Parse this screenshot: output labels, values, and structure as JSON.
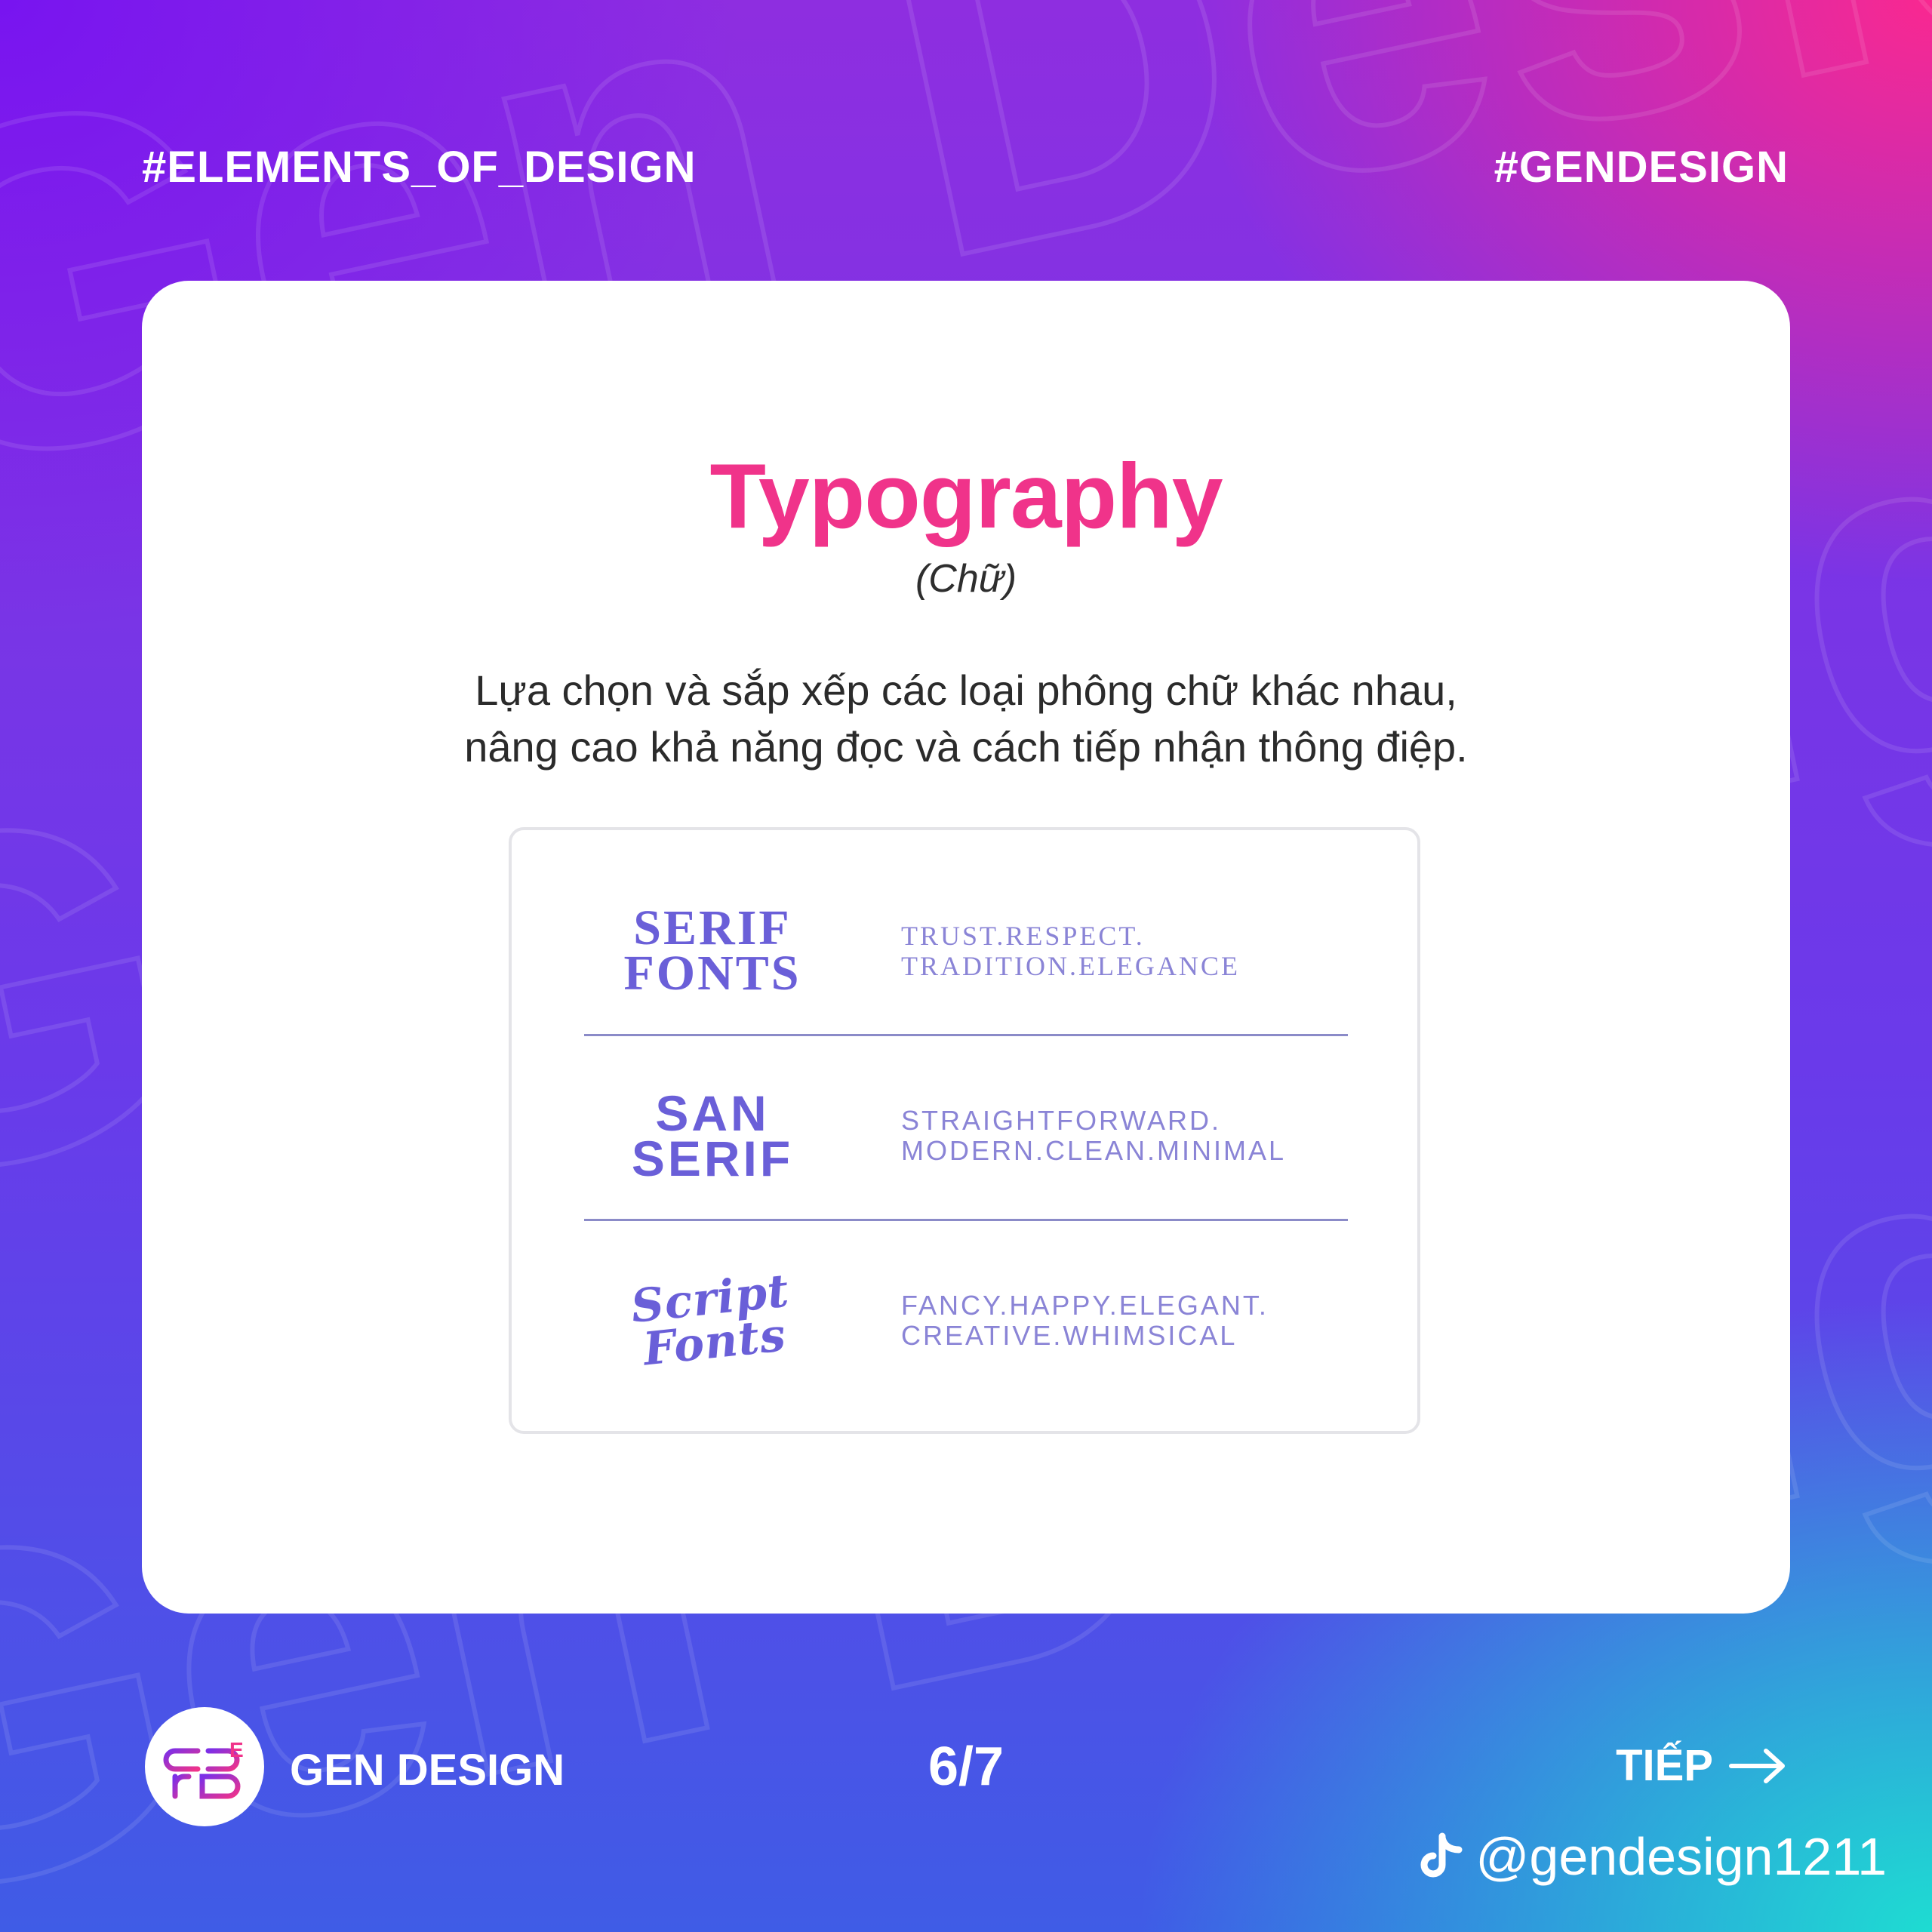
{
  "header": {
    "left_tag": "#ELEMENTS_OF_DESIGN",
    "right_tag": "#GENDESIGN"
  },
  "card": {
    "title": "Typography",
    "subtitle": "(Chữ)",
    "description_lines": [
      "Lựa chọn và sắp xếp các loại phông chữ khác nhau,",
      "nâng cao khả năng đọc và cách tiếp nhận thông điệp."
    ],
    "font_types": [
      {
        "name_lines": [
          "SERIF",
          "FONTS"
        ],
        "trait_lines": [
          "TRUST.RESPECT.",
          "TRADITION.ELEGANCE"
        ]
      },
      {
        "name_lines": [
          "SAN",
          "SERIF"
        ],
        "trait_lines": [
          "STRAIGHTFORWARD.",
          "MODERN.CLEAN.MINIMAL"
        ]
      },
      {
        "name_lines": [
          "Script",
          "Fonts"
        ],
        "trait_lines": [
          "FANCY.HAPPY.ELEGANT.",
          "CREATIVE.WHIMSICAL"
        ]
      }
    ]
  },
  "footer": {
    "logo_icon": "gen-design-logo-icon",
    "brand": "GEN DESIGN",
    "pager": "6/7",
    "next_label": "TIẾP",
    "next_icon": "arrow-right-icon",
    "social_icon": "tiktok-icon",
    "handle": "@gendesign1211"
  },
  "colors": {
    "title": "#f0338a",
    "font_name": "#6a5fd8",
    "traits": "#8a84d6",
    "gradient_top_left": "#7814f0",
    "gradient_top_right": "#ff288c",
    "gradient_bottom_right": "#1edcd2"
  }
}
